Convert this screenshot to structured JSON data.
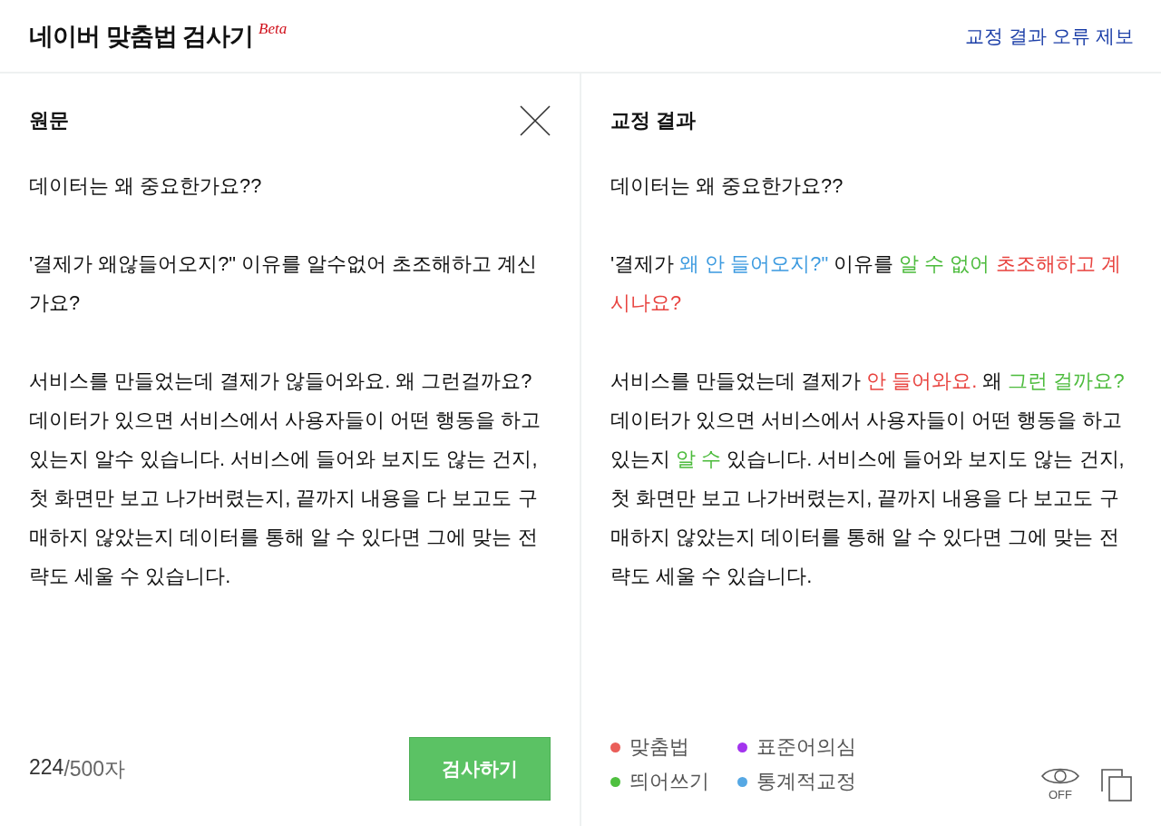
{
  "header": {
    "title": "네이버 맞춤법 검사기",
    "badge": "Beta",
    "report_link": "교정 결과 오류 제보"
  },
  "source": {
    "title": "원문",
    "paragraphs": [
      "데이터는 왜 중요한가요??",
      "'결제가 왜않들어오지?\" 이유를 알수없어 초조해하고 계신가요?",
      "서비스를 만들었는데 결제가 않들어와요. 왜 그런걸까요? 데이터가 있으면 서비스에서 사용자들이 어떤 행동을 하고 있는지 알수 있습니다. 서비스에 들어와 보지도 않는 건지, 첫 화면만 보고 나가버렸는지, 끝까지 내용을 다 보고도 구매하지 않았는지 데이터를 통해 알 수 있다면 그에 맞는 전략도 세울 수 있습니다."
    ],
    "count": "224",
    "limit": "/500자",
    "button": "검사하기"
  },
  "result": {
    "title": "교정 결과",
    "paragraphs": [
      [
        {
          "text": "데이터는 왜 중요한가요??"
        }
      ],
      [
        {
          "text": "'결제가 "
        },
        {
          "text": "왜 안 들어오지?\"",
          "color": "#3d9be0"
        },
        {
          "text": " 이유를 "
        },
        {
          "text": "알 수 없어 ",
          "color": "#4cbb3c"
        },
        {
          "text": "초조해하고 계시나요?",
          "color": "#e8433f"
        }
      ],
      [
        {
          "text": "서비스를 만들었는데 결제가 "
        },
        {
          "text": "안 들어와요.",
          "color": "#e8433f"
        },
        {
          "text": " 왜 "
        },
        {
          "text": "그런 걸까요?",
          "color": "#4cbb3c"
        },
        {
          "text": " 데이터가 있으면 서비스에서 사용자들이 어떤 행동을 하고 있는지 "
        },
        {
          "text": "알 수",
          "color": "#4cbb3c"
        },
        {
          "text": " 있습니다. 서비스에 들어와 보지도 않는 건지, 첫 화면만 보고 나가버렸는지, 끝까지 내용을 다 보고도 구매하지 않았는지 데이터를 통해 알 수 있다면 그에 맞는 전략도 세울 수 있습니다."
        }
      ]
    ],
    "legend": [
      {
        "label": "맞춤법",
        "color": "#ea5e59"
      },
      {
        "label": "표준어의심",
        "color": "#a334ee"
      },
      {
        "label": "띄어쓰기",
        "color": "#4fc03f"
      },
      {
        "label": "통계적교정",
        "color": "#56a8e4"
      }
    ],
    "view_toggle": {
      "label": "OFF",
      "on": false
    }
  }
}
